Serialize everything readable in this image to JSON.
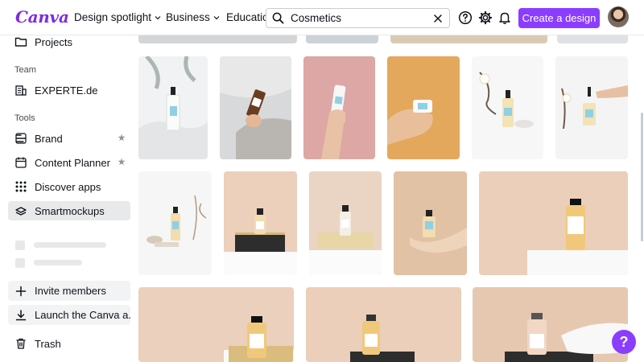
{
  "header": {
    "logo_text": "Canva",
    "nav": [
      {
        "label": "Design spotlight"
      },
      {
        "label": "Business"
      },
      {
        "label": "Educatio"
      }
    ],
    "search": {
      "value": "Cosmetics",
      "placeholder": ""
    },
    "create_button": "Create a design"
  },
  "sidebar": {
    "top_item": "Projects",
    "team_heading": "Team",
    "team_item": "EXPERTE.de",
    "tools_heading": "Tools",
    "tools": [
      {
        "label": "Brand"
      },
      {
        "label": "Content Planner"
      },
      {
        "label": "Discover apps"
      },
      {
        "label": "Smartmockups"
      }
    ],
    "invite": "Invite members",
    "launch": "Launch the Canva a...",
    "trash": "Trash"
  },
  "help_label": "?",
  "colors": {
    "brand": "#8b3dff",
    "logo": "#7d2ae8"
  }
}
